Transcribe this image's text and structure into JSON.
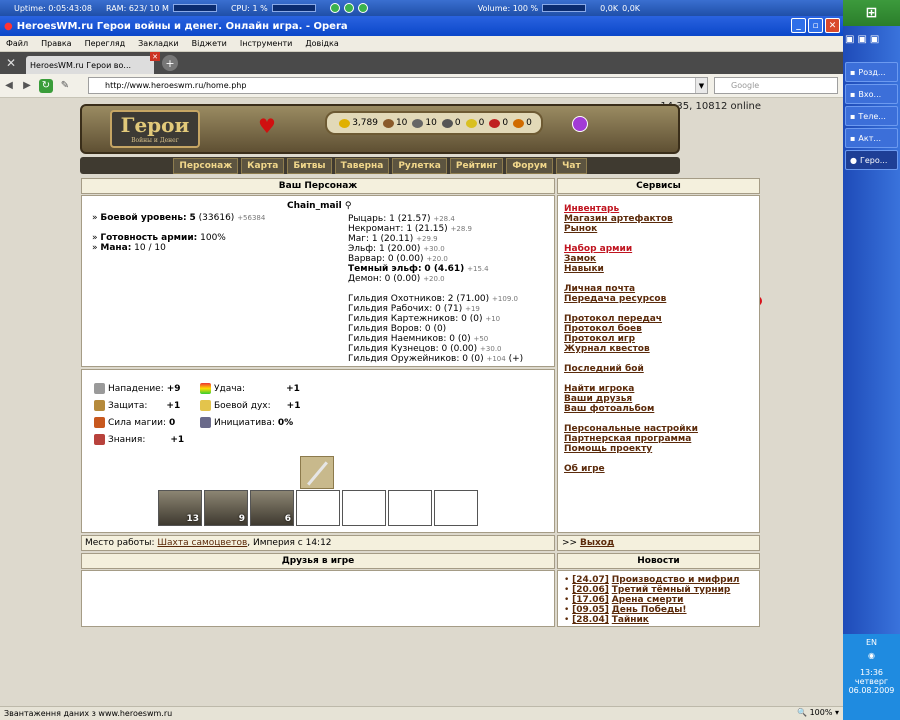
{
  "sysbar": {
    "uptime": "Uptime:  0:05:43:08",
    "ram": "RAM: 623/ 10 M",
    "cpu": "CPU: 1 %",
    "volume": "Volume: 100 %",
    "net1": "0,0K",
    "net2": "0,0K"
  },
  "window": {
    "title": "HeroesWM.ru Герои войны и денег. Онлайн игра. - Opera"
  },
  "menu": [
    "Файл",
    "Правка",
    "Перегляд",
    "Закладки",
    "Віджети",
    "Інструменти",
    "Довідка"
  ],
  "tab": {
    "label": "HeroesWM.ru Герои во..."
  },
  "nav": {
    "url": "http://www.heroeswm.ru/home.php",
    "search_placeholder": "Google"
  },
  "game": {
    "clock": "14:35, 10812 online",
    "logo": "Герои",
    "logo_sub": "Войны и Денег",
    "resources": [
      {
        "value": "3,789",
        "color": "#e0b000"
      },
      {
        "value": "10",
        "color": "#8a5a2a"
      },
      {
        "value": "10",
        "color": "#666"
      },
      {
        "value": "0",
        "color": "#555"
      },
      {
        "value": "0",
        "color": "#d9c020"
      },
      {
        "value": "0",
        "color": "#c02020"
      },
      {
        "value": "0",
        "color": "#d06b00"
      }
    ],
    "menu": [
      "Персонаж",
      "Карта",
      "Битвы",
      "Таверна",
      "Рулетка",
      "Рейтинг",
      "Форум",
      "Чат"
    ]
  },
  "character": {
    "header": "Ваш Персонаж",
    "name": "Chain_mail",
    "level_label": "Боевой уровень:",
    "level": "5",
    "level_exp": "(33616)",
    "level_next": "+56384",
    "army_label": "Готовность армии:",
    "army": "100%",
    "mana_label": "Мана:",
    "mana": "10 / 10",
    "factions": [
      {
        "name": "Рыцарь:",
        "value": "1 (21.57)",
        "plus": "+28.4"
      },
      {
        "name": "Некромант:",
        "value": "1 (21.15)",
        "plus": "+28.9"
      },
      {
        "name": "Маг:",
        "value": "1 (20.11)",
        "plus": "+29.9"
      },
      {
        "name": "Эльф:",
        "value": "1 (20.00)",
        "plus": "+30.0"
      },
      {
        "name": "Варвар:",
        "value": "0 (0.00)",
        "plus": "+20.0"
      },
      {
        "name": "Темный эльф:",
        "value": "0 (4.61)",
        "plus": "+15.4"
      },
      {
        "name": "Демон:",
        "value": "0 (0.00)",
        "plus": "+20.0"
      }
    ],
    "guilds": [
      {
        "name": "Гильдия Охотников:",
        "value": "2 (71.00)",
        "plus": "+109.0"
      },
      {
        "name": "Гильдия Рабочих:",
        "value": "0 (71)",
        "plus": "+19"
      },
      {
        "name": "Гильдия Картежников:",
        "value": "0 (0)",
        "plus": "+10"
      },
      {
        "name": "Гильдия Воров:",
        "value": "0 (0)",
        "plus": ""
      },
      {
        "name": "Гильдия Наемников:",
        "value": "0 (0)",
        "plus": "+50"
      },
      {
        "name": "Гильдия Кузнецов:",
        "value": "0 (0.00)",
        "plus": "+30.0"
      },
      {
        "name": "Гильдия Оружейников:",
        "value": "0 (0)",
        "plus": "+104"
      }
    ],
    "stats": [
      {
        "label": "Нападение:",
        "value": "+9"
      },
      {
        "label": "Защита:",
        "value": "+1"
      },
      {
        "label": "Сила магии:",
        "value": "0"
      },
      {
        "label": "Знания:",
        "value": "+1"
      }
    ],
    "stats2": [
      {
        "label": "Удача:",
        "value": "+1"
      },
      {
        "label": "Боевой дух:",
        "value": "+1"
      },
      {
        "label": "Инициатива:",
        "value": "0%"
      }
    ],
    "army_counts": [
      "13",
      "9",
      "6"
    ],
    "work_label": "Место работы:",
    "work_place": "Шахта самоцветов",
    "work_suffix": ", Империя с 14:12"
  },
  "friends": {
    "header": "Друзья в игре"
  },
  "services": {
    "header": "Сервисы",
    "groups": [
      [
        {
          "label": "Инвентарь",
          "red": true
        },
        {
          "label": "Магазин артефактов"
        },
        {
          "label": "Рынок"
        }
      ],
      [
        {
          "label": "Набор армии",
          "red": true
        },
        {
          "label": "Замок"
        },
        {
          "label": "Навыки"
        }
      ],
      [
        {
          "label": "Личная почта"
        },
        {
          "label": "Передача ресурсов"
        }
      ],
      [
        {
          "label": "Протокол передач"
        },
        {
          "label": "Протокол боев"
        },
        {
          "label": "Протокол игр"
        },
        {
          "label": "Журнал квестов"
        }
      ],
      [
        {
          "label": "Последний бой"
        }
      ],
      [
        {
          "label": "Найти игрока"
        },
        {
          "label": "Ваши друзья"
        },
        {
          "label": "Ваш фотоальбом"
        }
      ],
      [
        {
          "label": "Персональные настройки"
        },
        {
          "label": "Партнерская программа"
        },
        {
          "label": "Помощь проекту"
        }
      ],
      [
        {
          "label": "Об игре"
        }
      ]
    ],
    "exit_prefix": ">>",
    "exit": "Выход"
  },
  "news": {
    "header": "Новости",
    "items": [
      {
        "date": "[24.07]",
        "title": "Производство и мифрил"
      },
      {
        "date": "[20.06]",
        "title": "Третий тёмный турнир"
      },
      {
        "date": "[17.06]",
        "title": "Арена смерти"
      },
      {
        "date": "[09.05]",
        "title": "День Победы!"
      },
      {
        "date": "[28.04]",
        "title": "Тайник"
      }
    ]
  },
  "status": {
    "text": "Звантаження даних з www.heroeswm.ru",
    "zoom": "100%"
  },
  "taskbar": {
    "items": [
      "Розд...",
      "Вхо...",
      "Теле...",
      "Акт...",
      "Геро..."
    ],
    "lang": "EN",
    "time": "13:36",
    "day": "четверг",
    "date": "06.08.2009"
  }
}
